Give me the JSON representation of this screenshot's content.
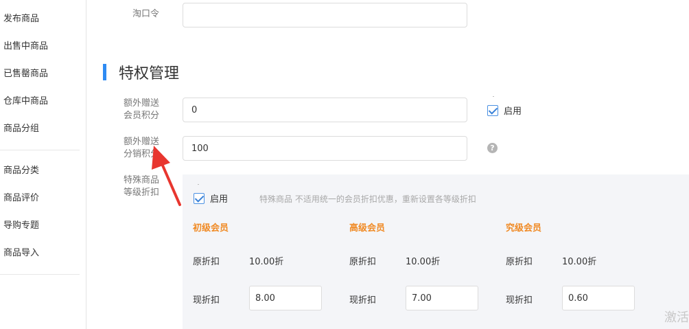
{
  "sidebar": {
    "items": [
      {
        "label": "发布商品"
      },
      {
        "label": "出售中商品"
      },
      {
        "label": "已售罄商品"
      },
      {
        "label": "仓库中商品"
      },
      {
        "label": "商品分组"
      },
      {
        "label": "商品分类"
      },
      {
        "label": "商品评价"
      },
      {
        "label": "导购专题"
      },
      {
        "label": "商品导入"
      }
    ]
  },
  "form": {
    "taokouling_label": "淘口令",
    "taokouling_value": ""
  },
  "privilege": {
    "title": "特权管理",
    "member_points_label_1": "额外赠送",
    "member_points_label_2": "会员积分",
    "member_points_value": "0",
    "member_points_enable_label": "启用",
    "member_points_enabled": true,
    "dist_points_label_1": "额外赠送",
    "dist_points_label_2": "分销积分",
    "dist_points_value": "100",
    "help_icon": "question-circle-icon",
    "special_label_1": "特殊商品",
    "special_label_2": "等级折扣",
    "special": {
      "enable_label": "启用",
      "enabled": true,
      "hint": "特殊商品 不适用统一的会员折扣优惠，重新设置各等级折扣",
      "original_label": "原折扣",
      "current_label": "现折扣",
      "levels": [
        {
          "name": "初级会员",
          "original": "10.00折",
          "current": "8.00"
        },
        {
          "name": "高级会员",
          "original": "10.00折",
          "current": "7.00"
        },
        {
          "name": "究级会员",
          "original": "10.00折",
          "current": "0.60"
        }
      ]
    }
  },
  "watermark": {
    "text": "激活"
  },
  "colors": {
    "accent": "#2e8bf3",
    "level_title": "#f08a24",
    "annotation_arrow": "#e8362f",
    "panel_bg": "#f4f5f8"
  }
}
